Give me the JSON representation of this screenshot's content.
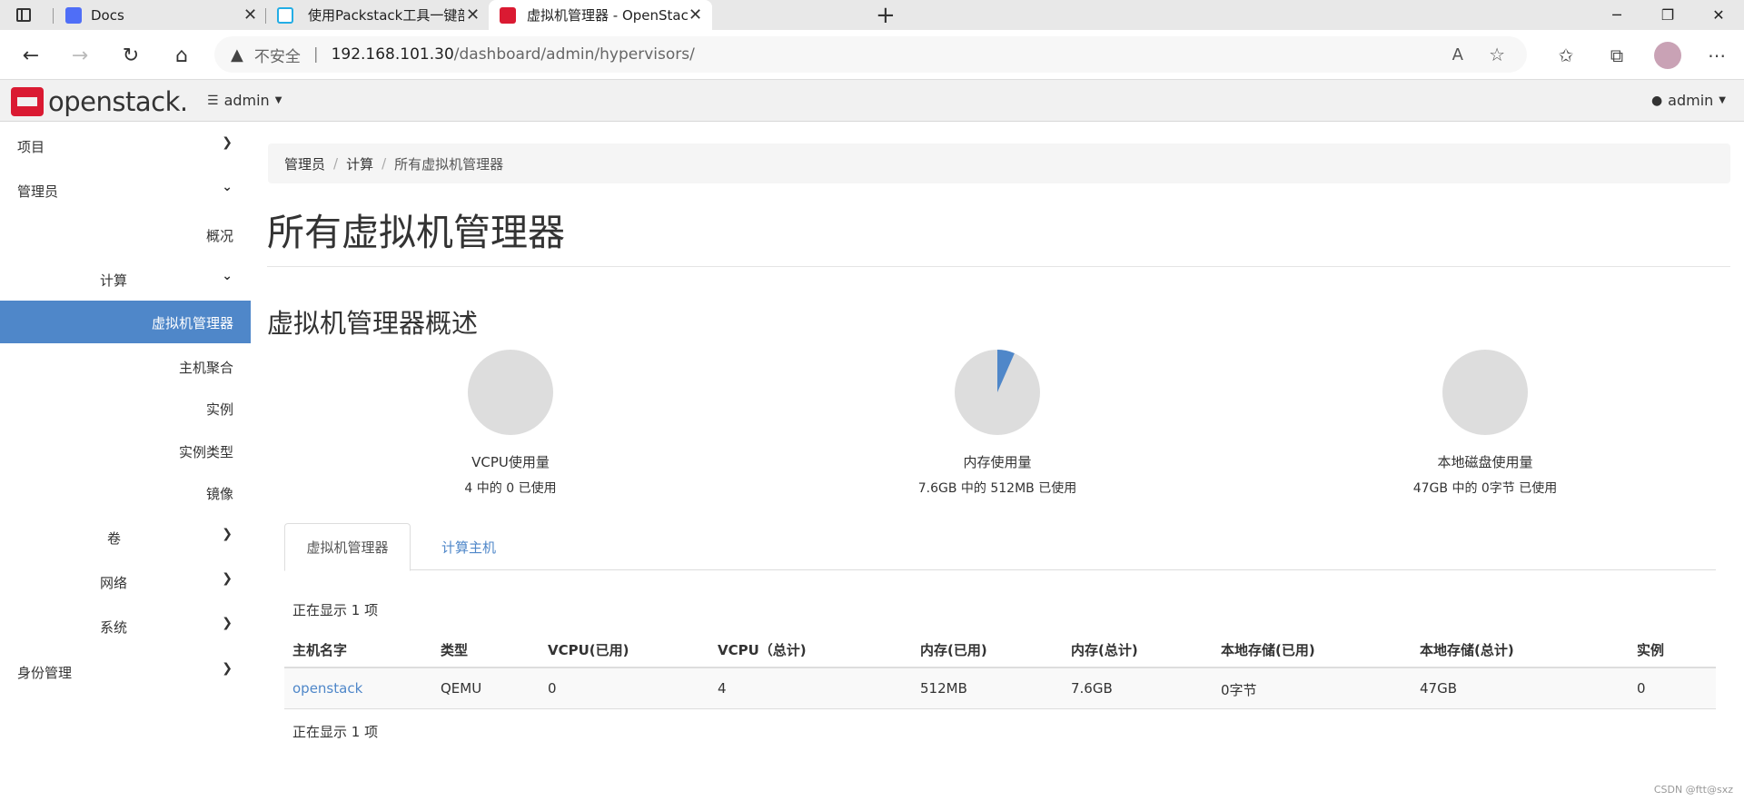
{
  "browser": {
    "tabs": [
      {
        "title": "Docs"
      },
      {
        "title": "使用Packstack工具一键部署Oper"
      },
      {
        "title": "虚拟机管理器 - OpenStack Dashl"
      }
    ],
    "new_tab": "+",
    "address": {
      "security": "不安全",
      "host": "192.168.101.30",
      "path": "/dashboard/admin/hypervisors/"
    }
  },
  "header": {
    "logo_text": "openstack.",
    "project": "admin",
    "user": "admin"
  },
  "sidebar": {
    "items": [
      {
        "label": "项目"
      },
      {
        "label": "管理员"
      },
      {
        "label": "概况"
      },
      {
        "label": "计算"
      },
      {
        "label": "虚拟机管理器"
      },
      {
        "label": "主机聚合"
      },
      {
        "label": "实例"
      },
      {
        "label": "实例类型"
      },
      {
        "label": "镜像"
      },
      {
        "label": "卷"
      },
      {
        "label": "网络"
      },
      {
        "label": "系统"
      },
      {
        "label": "身份管理"
      }
    ]
  },
  "breadcrumb": [
    "管理员",
    "计算",
    "所有虚拟机管理器"
  ],
  "page_title": "所有虚拟机管理器",
  "summary": {
    "title": "虚拟机管理器概述",
    "charts": [
      {
        "label": "VCPU使用量",
        "detail": "4 中的 0 已使用",
        "used_fraction": 0
      },
      {
        "label": "内存使用量",
        "detail": "7.6GB 中的 512MB 已使用",
        "used_fraction": 0.0658
      },
      {
        "label": "本地磁盘使用量",
        "detail": "47GB 中的 0字节 已使用",
        "used_fraction": 0
      }
    ]
  },
  "colors": {
    "accent": "#4f87c9",
    "pie_bg": "#dddddd",
    "pie_used": "#4f87c9",
    "logo_red": "#da1a32"
  },
  "tabs": [
    "虚拟机管理器",
    "计算主机"
  ],
  "table": {
    "count_text": "正在显示 1 项",
    "columns": [
      "主机名字",
      "类型",
      "VCPU(已用)",
      "VCPU（总计)",
      "内存(已用)",
      "内存(总计)",
      "本地存储(已用)",
      "本地存储(总计)",
      "实例"
    ],
    "rows": [
      [
        "openstack",
        "QEMU",
        "0",
        "4",
        "512MB",
        "7.6GB",
        "0字节",
        "47GB",
        "0"
      ]
    ]
  },
  "watermark": "CSDN @ftt@sxz"
}
